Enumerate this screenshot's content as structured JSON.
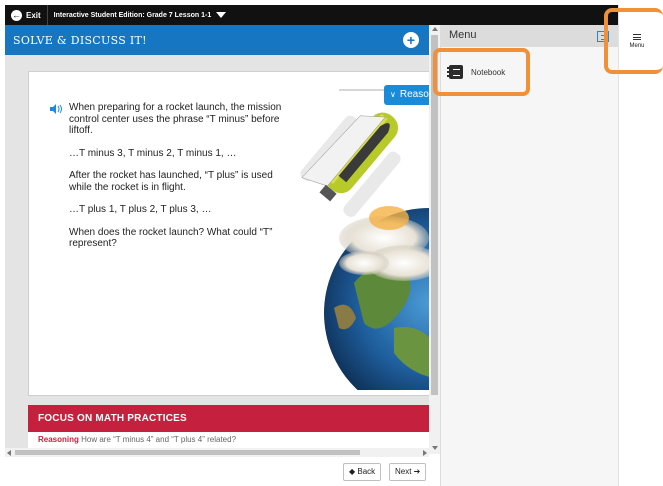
{
  "topbar": {
    "exit_label": "Exit",
    "course_title": "Interactive Student Edition: Grade 7 Lesson 1-1"
  },
  "lesson": {
    "title": "SOLVE & DISCUSS IT!",
    "reasoning_tab": "Reasoning",
    "prompt": [
      "When preparing for a rocket launch, the mission control center uses the phrase “T minus” before liftoff.",
      "…T minus 3, T minus 2, T minus 1, …",
      "After the rocket has launched, “T plus” is used while the rocket is in flight.",
      "…T plus 1, T plus 2, T plus 3, …",
      "When does the rocket launch? What could “T” represent?"
    ],
    "focus": {
      "heading": "FOCUS ON MATH PRACTICES",
      "keyword": "Reasoning",
      "text": " How are “T minus 4” and “T plus 4” related?"
    }
  },
  "nav": {
    "back_label": "◆ Back",
    "next_label": "Next ➔"
  },
  "menu_panel": {
    "header": "Menu",
    "items": [
      {
        "label": "Notebook",
        "icon": "notebook-icon"
      }
    ]
  },
  "menu_toggle": {
    "label": "Menu",
    "icon": "hamburger-icon"
  },
  "colors": {
    "header_blue": "#1676c1",
    "reasoning_blue": "#1a8bd8",
    "focus_red": "#c5213e",
    "highlight_orange": "#f0913a"
  }
}
